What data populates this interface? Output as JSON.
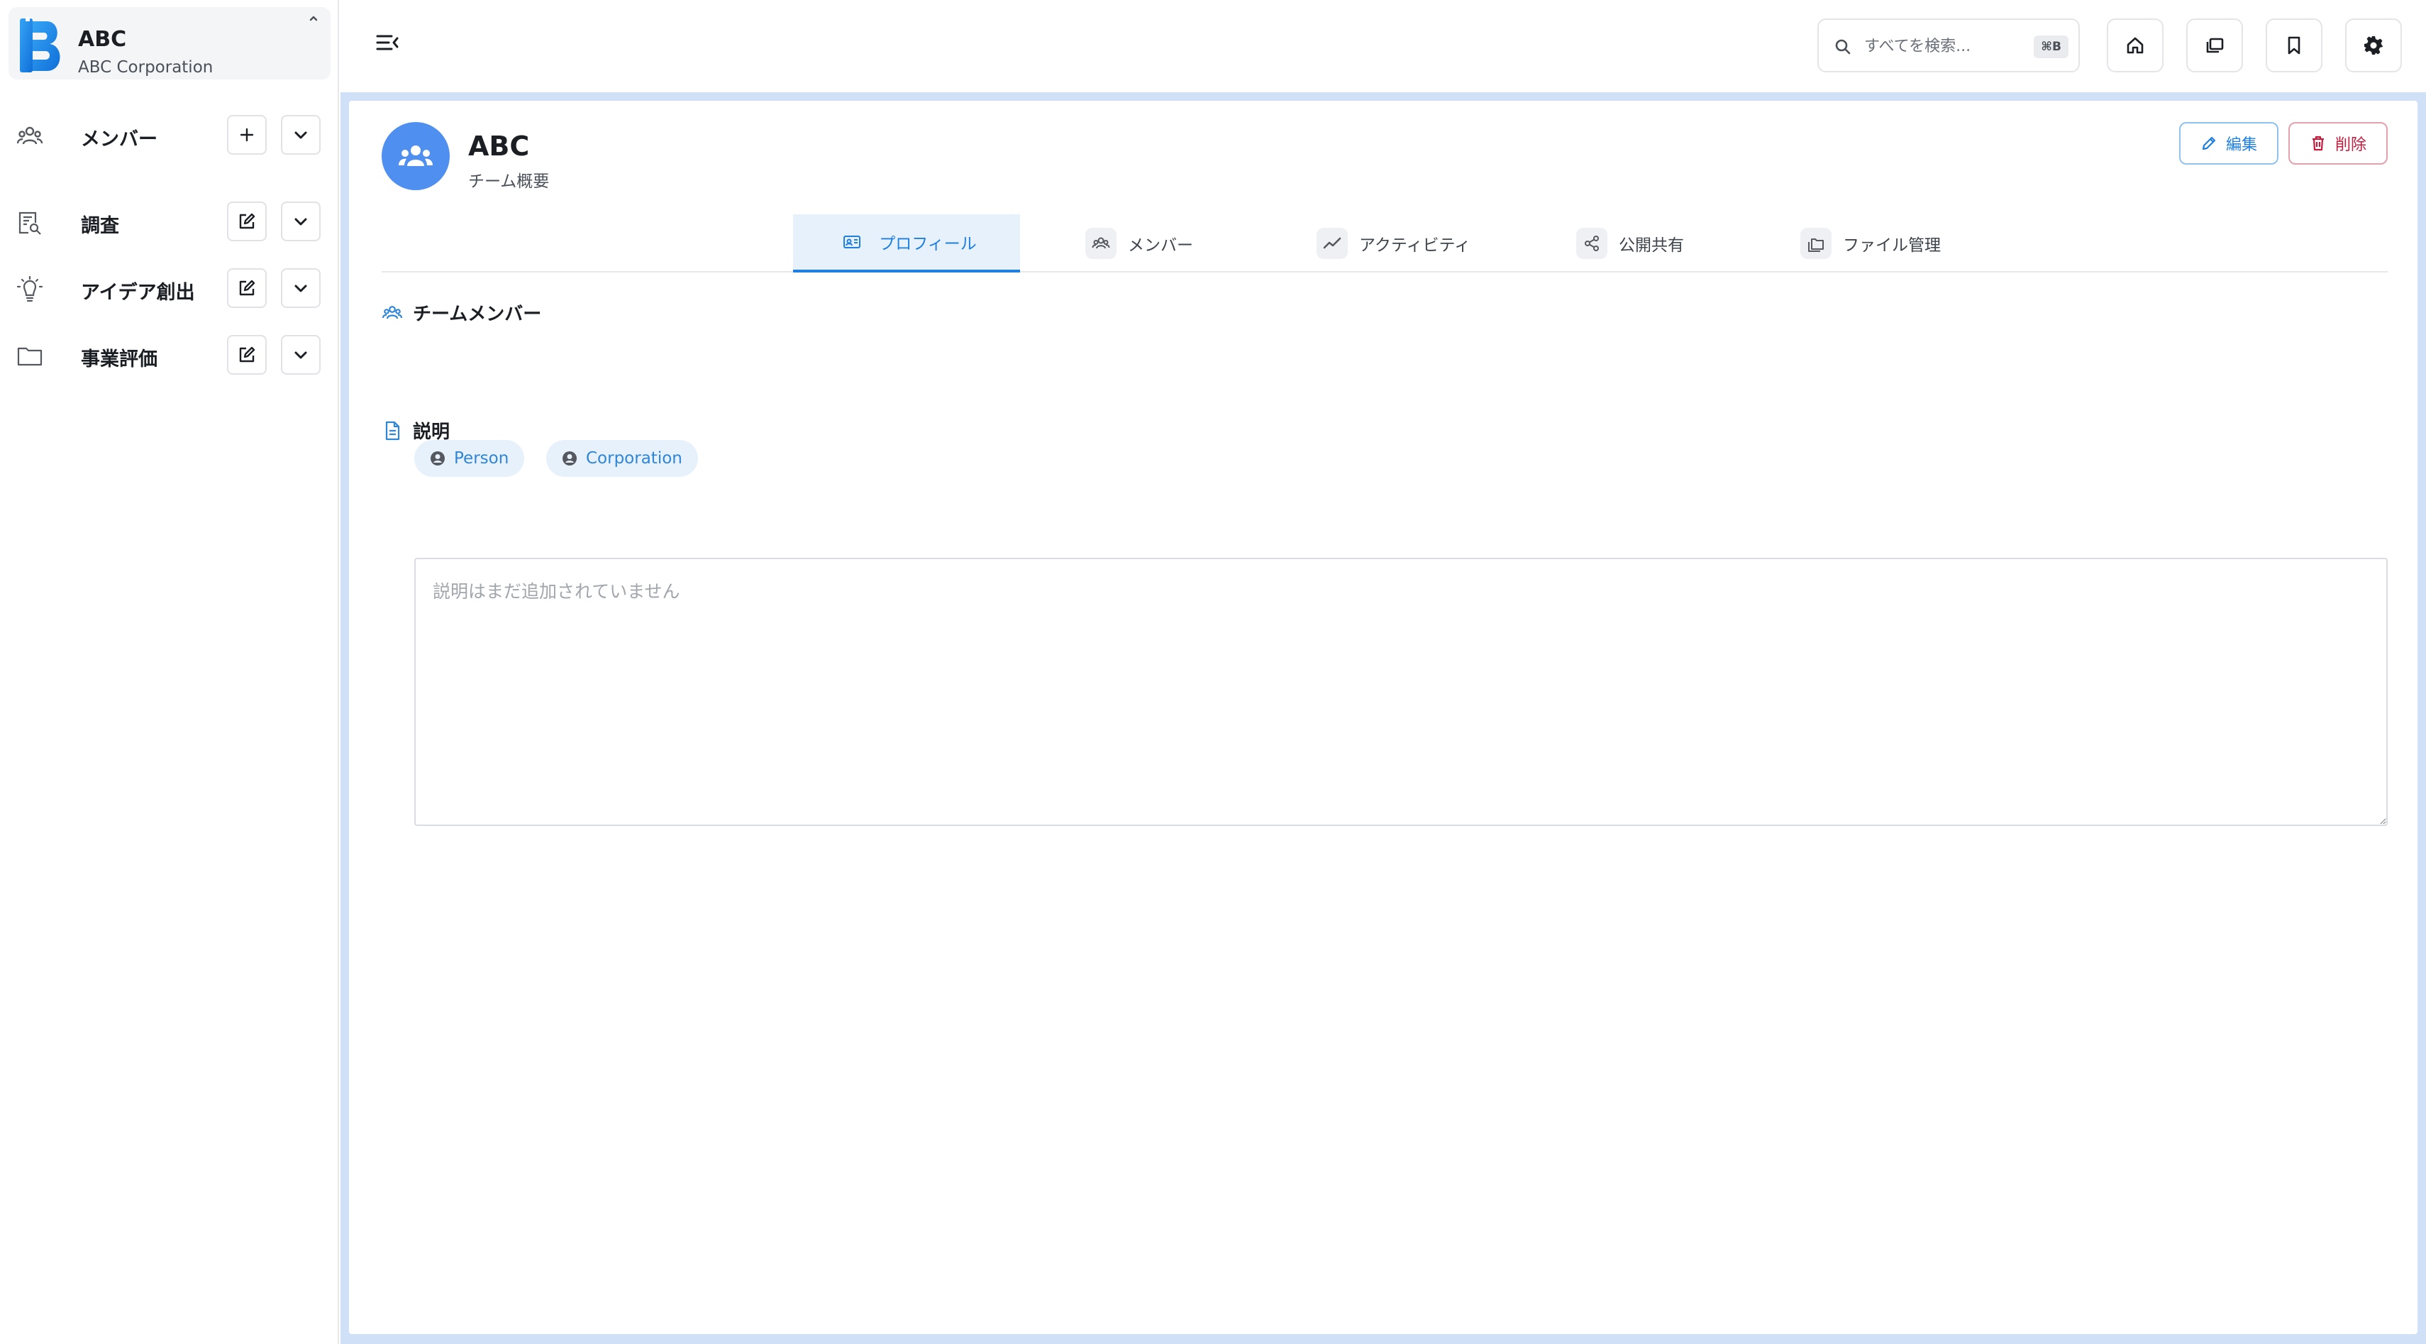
{
  "org": {
    "name": "ABC",
    "subtitle": "ABC Corporation",
    "logo_color": "#1e88e5"
  },
  "sidebar": {
    "items": [
      {
        "label": "メンバー",
        "icon": "users-icon",
        "action": "add-icon"
      },
      {
        "label": "調査",
        "icon": "research-icon",
        "action": "edit-icon"
      },
      {
        "label": "アイデア創出",
        "icon": "lightbulb-icon",
        "action": "edit-icon"
      },
      {
        "label": "事業評価",
        "icon": "folder-icon",
        "action": "edit-icon"
      }
    ]
  },
  "header": {
    "search": {
      "placeholder": "すべてを検索...",
      "shortcut": "⌘B"
    },
    "buttons": [
      "home-icon",
      "pages-icon",
      "bookmark-icon",
      "gear-icon"
    ]
  },
  "team": {
    "name": "ABC",
    "subtitle": "チーム概要"
  },
  "actions": {
    "edit_label": "編集",
    "delete_label": "削除"
  },
  "tabs": [
    {
      "label": "プロフィール",
      "active": true
    },
    {
      "label": "メンバー",
      "active": false
    },
    {
      "label": "アクティビティ",
      "active": false
    },
    {
      "label": "公開共有",
      "active": false
    },
    {
      "label": "ファイル管理",
      "active": false
    }
  ],
  "members_section": {
    "title": "チームメンバー",
    "chips": [
      "Person",
      "Corporation"
    ]
  },
  "description_section": {
    "title": "説明",
    "placeholder": "説明はまだ追加されていません"
  },
  "colors": {
    "accent": "#1f7fe0",
    "danger": "#c21d3c",
    "frame": "#cfe0f7"
  }
}
